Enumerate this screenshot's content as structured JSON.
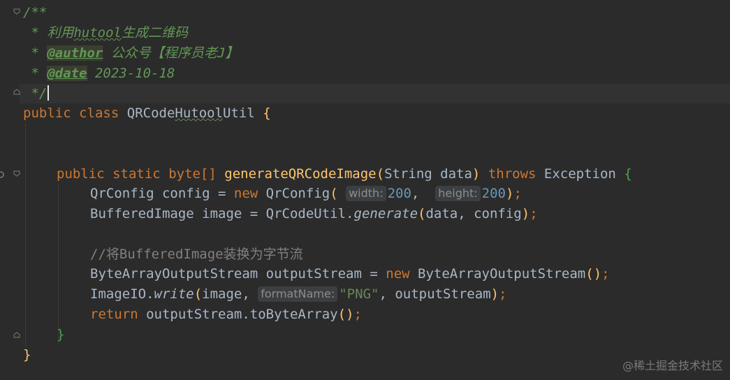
{
  "code": {
    "doc_open": "/**",
    "doc_line1_prefix": " * ",
    "doc_line1_a": "利用",
    "doc_line1_b": "hutool",
    "doc_line1_c": "生成二维码",
    "doc_author_tag": "@author",
    "doc_author_text": " 公众号【程序员老J】",
    "doc_date_tag": "@date",
    "doc_date_text": " 2023-10-18",
    "doc_close": " */",
    "class_public": "public",
    "class_kw": "class",
    "class_name_a": "QRCode",
    "class_name_b": "Hutool",
    "class_name_c": "Util",
    "class_brace": "{",
    "m_public": "public",
    "m_static": "static",
    "m_type": "byte[]",
    "m_name": "generateQRCodeImage",
    "m_paren_open": "(",
    "m_params": "String data",
    "m_paren_close": ")",
    "m_throws": "throws",
    "m_exc": "Exception",
    "m_brace": "{",
    "l1_a": "QrConfig config = ",
    "l1_new": "new",
    "l1_b": " QrConfig",
    "l1_paren": "(",
    "hint_width": "width:",
    "num_200a": "200",
    "comma": ", ",
    "hint_height": "height:",
    "num_200b": "200",
    "l1_close": ")",
    "semi": ";",
    "l2_a": "BufferedImage image = QrCodeUtil.",
    "l2_gen": "generate",
    "l2_paren": "(",
    "l2_args": "data, config",
    "l2_close": ")",
    "comment": "//将BufferedImage装换为字节流",
    "l3_a": "ByteArrayOutputStream outputStream = ",
    "l3_new": "new",
    "l3_b": " ByteArrayOutputStream",
    "l3_parens": "()",
    "l4_a": "ImageIO.",
    "l4_write": "write",
    "l4_paren": "(",
    "l4_image": "image, ",
    "hint_format": "formatName:",
    "str_png": "\"PNG\"",
    "l4_rest": ", outputStream",
    "l4_close": ")",
    "l5_return": "return",
    "l5_a": " outputStream.toByteArray",
    "l5_parens": "()",
    "close_method": "}",
    "close_class": "}"
  },
  "watermark": "@稀土掘金技术社区",
  "colors": {
    "background": "#2b2b2b",
    "keyword": "#cc7832",
    "function": "#ffc66d",
    "number": "#6897bb",
    "string": "#6a8759",
    "doc": "#629755",
    "comment": "#808080",
    "text": "#a9b7c6"
  },
  "icons": [
    "fold-icon",
    "override-icon"
  ]
}
